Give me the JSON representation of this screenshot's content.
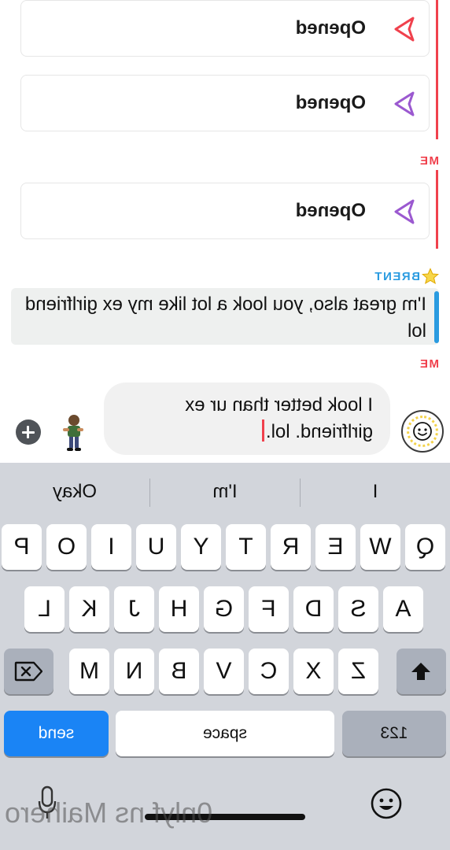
{
  "chat": {
    "snaps": [
      {
        "label": "Opened",
        "color": "#f0414d"
      },
      {
        "label": "Opened",
        "color": "#9b59d0"
      },
      {
        "label": "Opened",
        "color": "#9b59d0"
      }
    ],
    "sender_me": "ME",
    "sender_brent": "BRENT",
    "brent_message": "I'm great also, you look a lot like my ex girlfriend lol",
    "sender_me_2": "ME"
  },
  "composer": {
    "text": "I look better than ur ex girlfriend. lol."
  },
  "keyboard": {
    "suggestions": [
      "I",
      "I'm",
      "Okay"
    ],
    "row1": [
      "Q",
      "W",
      "E",
      "R",
      "T",
      "Y",
      "U",
      "I",
      "O",
      "P"
    ],
    "row2": [
      "A",
      "S",
      "D",
      "F",
      "G",
      "H",
      "J",
      "K",
      "L"
    ],
    "row3": [
      "Z",
      "X",
      "C",
      "V",
      "B",
      "N",
      "M"
    ],
    "numbers_label": "123",
    "space_label": "space",
    "send_label": "send"
  },
  "colors": {
    "snap_red": "#f0414d",
    "snap_purple": "#9b59d0",
    "chat_blue": "#2a9be0",
    "send_blue": "#1a84f5"
  },
  "icons": [
    "send-arrow-icon",
    "star-icon",
    "bitmoji-face-icon",
    "sticker-icon",
    "plus-icon",
    "shift-icon",
    "backspace-icon",
    "emoji-icon",
    "microphone-icon"
  ],
  "watermark": "0nlyf ns Maihero"
}
